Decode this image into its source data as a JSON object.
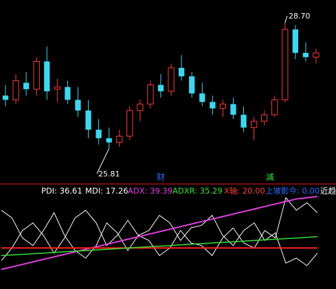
{
  "colors": {
    "up": "#ff3b3b",
    "down": "#3fd6ee",
    "separator": "#c01818",
    "pdi": "#ffffff",
    "mdi": "#ffffff",
    "adx": "#e040e0",
    "adxr": "#39e039",
    "axis_line": "#ff2020",
    "shangpo": "#2a6cff",
    "jinchao": "#ffffff"
  },
  "chart_data": [
    {
      "type": "candlestick",
      "ylim": [
        25.3,
        29.0
      ],
      "annotations": {
        "low_label": "25.81",
        "high_label": "28.70",
        "finance_marker": "财",
        "reduce_marker": "減"
      },
      "candles": [
        {
          "o": 27.05,
          "h": 27.3,
          "l": 26.8,
          "c": 26.95
        },
        {
          "o": 26.95,
          "h": 27.55,
          "l": 26.85,
          "c": 27.4
        },
        {
          "o": 27.35,
          "h": 27.6,
          "l": 27.05,
          "c": 27.2
        },
        {
          "o": 27.2,
          "h": 27.95,
          "l": 27.05,
          "c": 27.85
        },
        {
          "o": 27.85,
          "h": 28.2,
          "l": 26.95,
          "c": 27.15
        },
        {
          "o": 27.2,
          "h": 27.45,
          "l": 26.9,
          "c": 27.25
        },
        {
          "o": 27.25,
          "h": 27.4,
          "l": 26.85,
          "c": 26.95
        },
        {
          "o": 26.95,
          "h": 27.25,
          "l": 26.55,
          "c": 26.7
        },
        {
          "o": 26.7,
          "h": 26.95,
          "l": 26.05,
          "c": 26.25
        },
        {
          "o": 26.25,
          "h": 26.5,
          "l": 25.9,
          "c": 26.05
        },
        {
          "o": 26.05,
          "h": 26.3,
          "l": 25.81,
          "c": 25.95
        },
        {
          "o": 25.95,
          "h": 26.25,
          "l": 25.85,
          "c": 26.1
        },
        {
          "o": 26.1,
          "h": 26.8,
          "l": 26.0,
          "c": 26.7
        },
        {
          "o": 26.7,
          "h": 26.95,
          "l": 26.45,
          "c": 26.85
        },
        {
          "o": 26.85,
          "h": 27.4,
          "l": 26.75,
          "c": 27.3
        },
        {
          "o": 27.3,
          "h": 27.55,
          "l": 27.0,
          "c": 27.15
        },
        {
          "o": 27.15,
          "h": 27.8,
          "l": 27.05,
          "c": 27.7
        },
        {
          "o": 27.7,
          "h": 28.0,
          "l": 27.4,
          "c": 27.5
        },
        {
          "o": 27.5,
          "h": 27.6,
          "l": 27.0,
          "c": 27.1
        },
        {
          "o": 27.1,
          "h": 27.35,
          "l": 26.8,
          "c": 26.9
        },
        {
          "o": 26.9,
          "h": 27.05,
          "l": 26.6,
          "c": 26.75
        },
        {
          "o": 26.75,
          "h": 26.95,
          "l": 26.55,
          "c": 26.85
        },
        {
          "o": 26.85,
          "h": 27.0,
          "l": 26.5,
          "c": 26.6
        },
        {
          "o": 26.6,
          "h": 26.8,
          "l": 26.2,
          "c": 26.3
        },
        {
          "o": 26.3,
          "h": 26.55,
          "l": 26.0,
          "c": 26.45
        },
        {
          "o": 26.45,
          "h": 26.7,
          "l": 26.35,
          "c": 26.6
        },
        {
          "o": 26.6,
          "h": 27.05,
          "l": 26.55,
          "c": 26.95
        },
        {
          "o": 26.95,
          "h": 28.75,
          "l": 26.9,
          "c": 28.6
        },
        {
          "o": 28.6,
          "h": 28.7,
          "l": 27.9,
          "c": 28.05
        },
        {
          "o": 28.05,
          "h": 28.3,
          "l": 27.85,
          "c": 27.95
        },
        {
          "o": 27.95,
          "h": 28.15,
          "l": 27.8,
          "c": 28.05
        }
      ]
    },
    {
      "type": "line",
      "indicator_labels": [
        {
          "key": "pdi",
          "text": "PDI: 36.61"
        },
        {
          "key": "mdi",
          "text": "MDI: 17.26"
        },
        {
          "key": "adx",
          "text": "ADX: 39.39"
        },
        {
          "key": "adxr",
          "text": "ADXR: 35.29"
        },
        {
          "key": "axis_line",
          "text": "X轴: 20.00"
        },
        {
          "key": "shangpo",
          "text": "上坡影今: 0.00"
        },
        {
          "key": "jinchao",
          "text": "近趋"
        }
      ],
      "ylim": [
        0,
        60
      ],
      "series": [
        {
          "key": "pdi",
          "values": [
            50,
            44,
            28,
            22,
            34,
            48,
            30,
            18,
            12,
            22,
            40,
            32,
            18,
            30,
            26,
            14,
            20,
            34,
            24,
            22,
            14,
            28,
            36,
            24,
            20,
            34,
            28,
            60,
            50,
            56,
            48
          ]
        },
        {
          "key": "mdi",
          "values": [
            10,
            20,
            34,
            40,
            30,
            16,
            28,
            44,
            50,
            40,
            22,
            30,
            42,
            30,
            34,
            46,
            40,
            26,
            36,
            38,
            46,
            30,
            22,
            34,
            40,
            26,
            32,
            8,
            12,
            6,
            16
          ]
        },
        {
          "key": "adx",
          "values": [
            3,
            5,
            7,
            9,
            11,
            13,
            15,
            17,
            19,
            21,
            23,
            25,
            27,
            29,
            31,
            33,
            35,
            37,
            39,
            41,
            43,
            45,
            47,
            49,
            51,
            53,
            55,
            57,
            59,
            60,
            61
          ]
        },
        {
          "key": "axis_line",
          "values": [
            20,
            20,
            20,
            20,
            20,
            20,
            20,
            20,
            20,
            20,
            20,
            20,
            20,
            20,
            20,
            20,
            20,
            20,
            20,
            20,
            20,
            20,
            20,
            20,
            20,
            20,
            20,
            20,
            20,
            20,
            20
          ]
        },
        {
          "key": "adxr",
          "values": [
            14,
            14.5,
            15,
            15.5,
            16,
            16.5,
            17,
            17.5,
            18,
            18.5,
            19,
            19.5,
            20,
            20.5,
            21,
            21.5,
            22,
            22.5,
            23,
            23.5,
            24,
            24.5,
            25,
            25.5,
            26,
            26.5,
            27,
            27.5,
            28,
            28.5,
            29
          ]
        }
      ]
    }
  ]
}
